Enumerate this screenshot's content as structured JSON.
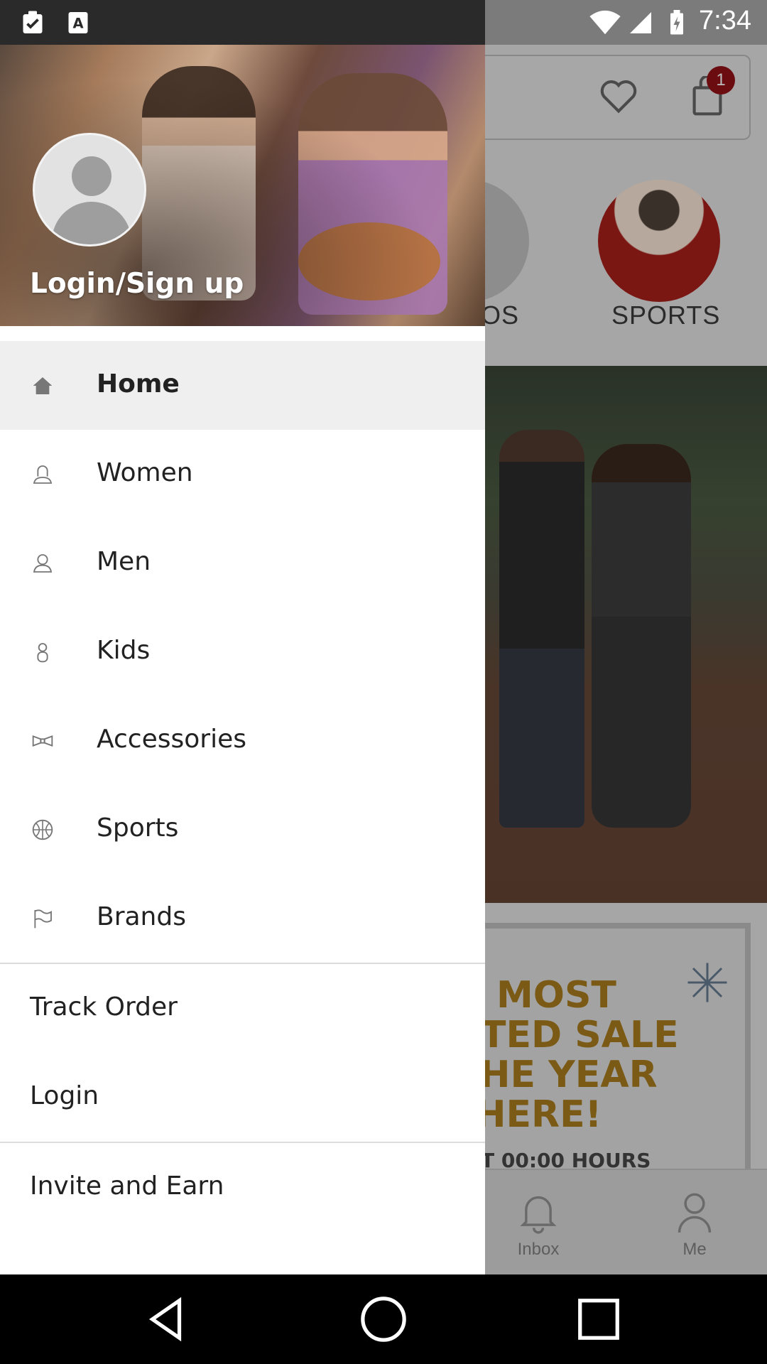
{
  "status_bar": {
    "time": "7:34",
    "icons": [
      "clipboard-check-icon",
      "font-a-icon",
      "wifi-icon",
      "signal-icon",
      "battery-charging-icon"
    ]
  },
  "background_app": {
    "cart_badge": "1",
    "categories": [
      {
        "label": "OS"
      },
      {
        "label": "SPORTS"
      }
    ],
    "promo_lines": [
      "MOST",
      "TED SALE",
      "HE YEAR",
      "HERE!",
      "T 00:00 HOURS"
    ],
    "bottom_nav": [
      {
        "label": "Inbox",
        "icon": "bell-icon"
      },
      {
        "label": "Me",
        "icon": "person-icon"
      }
    ]
  },
  "drawer": {
    "header": {
      "login_title": "Login/Sign up"
    },
    "menu": [
      {
        "label": "Home",
        "icon": "home-icon",
        "active": true
      },
      {
        "label": "Women",
        "icon": "woman-icon"
      },
      {
        "label": "Men",
        "icon": "man-icon"
      },
      {
        "label": "Kids",
        "icon": "kid-icon"
      },
      {
        "label": "Accessories",
        "icon": "bowtie-icon"
      },
      {
        "label": "Sports",
        "icon": "ball-icon"
      },
      {
        "label": "Brands",
        "icon": "flag-icon"
      }
    ],
    "secondary": [
      {
        "label": "Track Order"
      },
      {
        "label": "Login"
      }
    ],
    "tertiary": [
      {
        "label": "Invite and Earn"
      }
    ]
  },
  "colors": {
    "active_bg": "#efefef",
    "badge": "#6a0c10",
    "promo_text": "#7a5a15"
  }
}
